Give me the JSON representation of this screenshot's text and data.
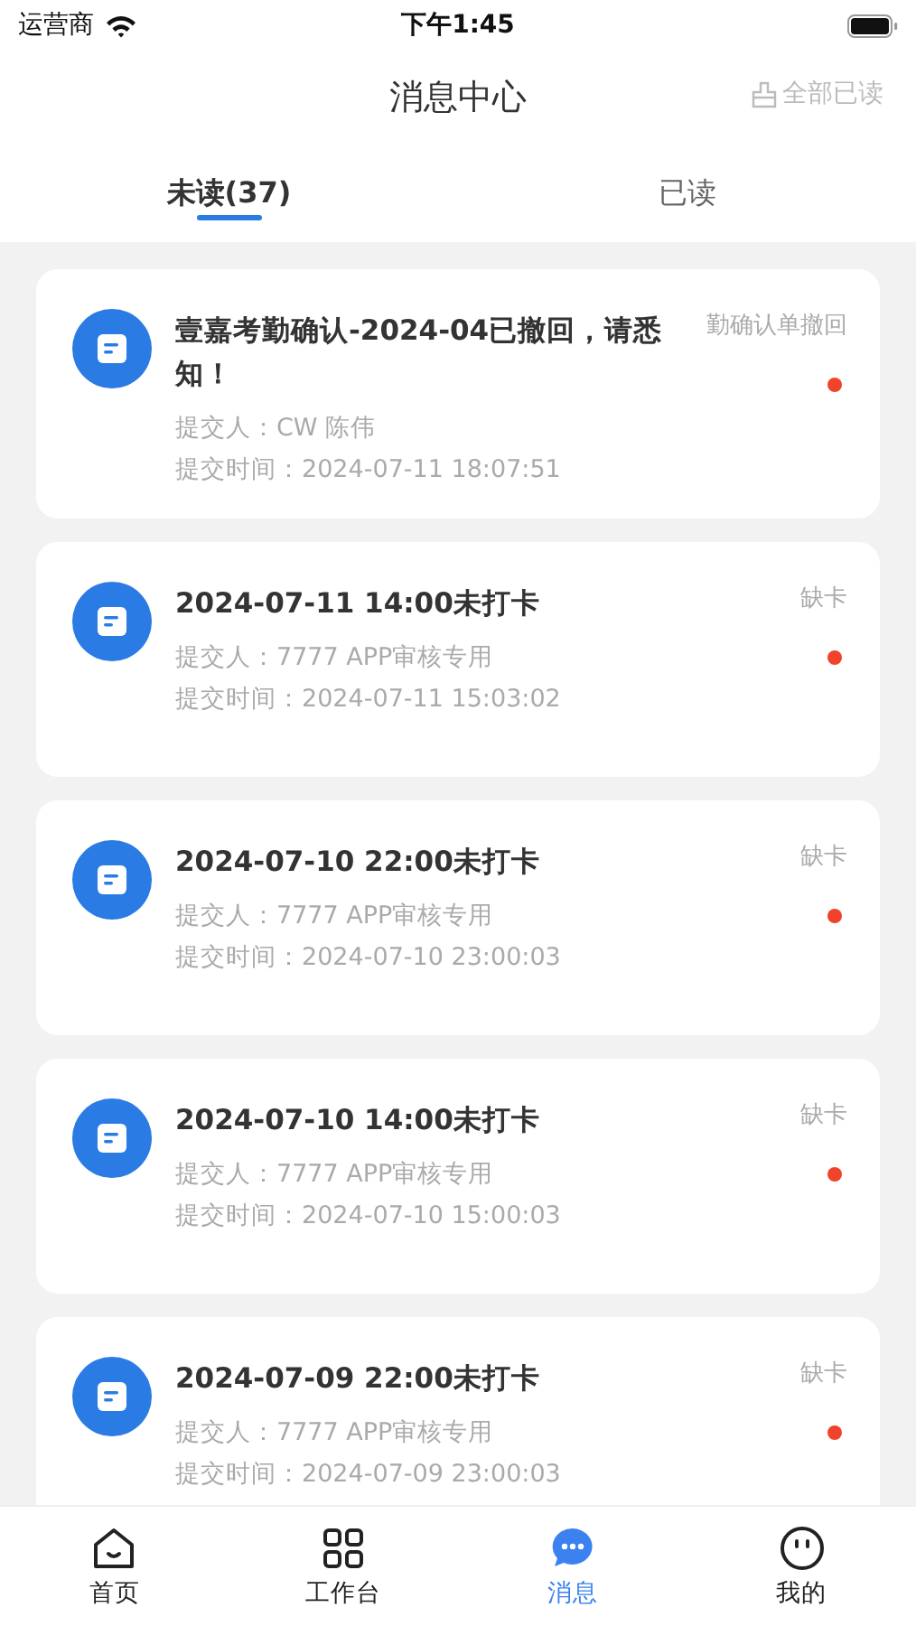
{
  "status_bar": {
    "carrier": "运营商",
    "time": "下午1:45"
  },
  "header": {
    "title": "消息中心",
    "action": "全部已读"
  },
  "tabs": [
    {
      "label": "未读(37)",
      "selected": true
    },
    {
      "label": "已读",
      "selected": false
    }
  ],
  "messages": [
    {
      "title": "壹嘉考勤确认-2024-04已撤回，请悉知！",
      "type": "勤确认单撤回",
      "submitter": "提交人：CW 陈伟",
      "time": "提交时间：2024-07-11 18:07:51",
      "unread": true
    },
    {
      "title": "2024-07-11 14:00未打卡",
      "type": "缺卡",
      "submitter": "提交人：7777 APP审核专用",
      "time": "提交时间：2024-07-11 15:03:02",
      "unread": true
    },
    {
      "title": "2024-07-10 22:00未打卡",
      "type": "缺卡",
      "submitter": "提交人：7777 APP审核专用",
      "time": "提交时间：2024-07-10 23:00:03",
      "unread": true
    },
    {
      "title": "2024-07-10 14:00未打卡",
      "type": "缺卡",
      "submitter": "提交人：7777 APP审核专用",
      "time": "提交时间：2024-07-10 15:00:03",
      "unread": true
    },
    {
      "title": "2024-07-09 22:00未打卡",
      "type": "缺卡",
      "submitter": "提交人：7777 APP审核专用",
      "time": "提交时间：2024-07-09 23:00:03",
      "unread": true
    }
  ],
  "tab_bar": [
    {
      "kind": "home",
      "label": "首页",
      "selected": false
    },
    {
      "kind": "grid",
      "label": "工作台",
      "selected": false
    },
    {
      "kind": "chat",
      "label": "消息",
      "selected": true
    },
    {
      "kind": "face",
      "label": "我的",
      "selected": false
    }
  ]
}
